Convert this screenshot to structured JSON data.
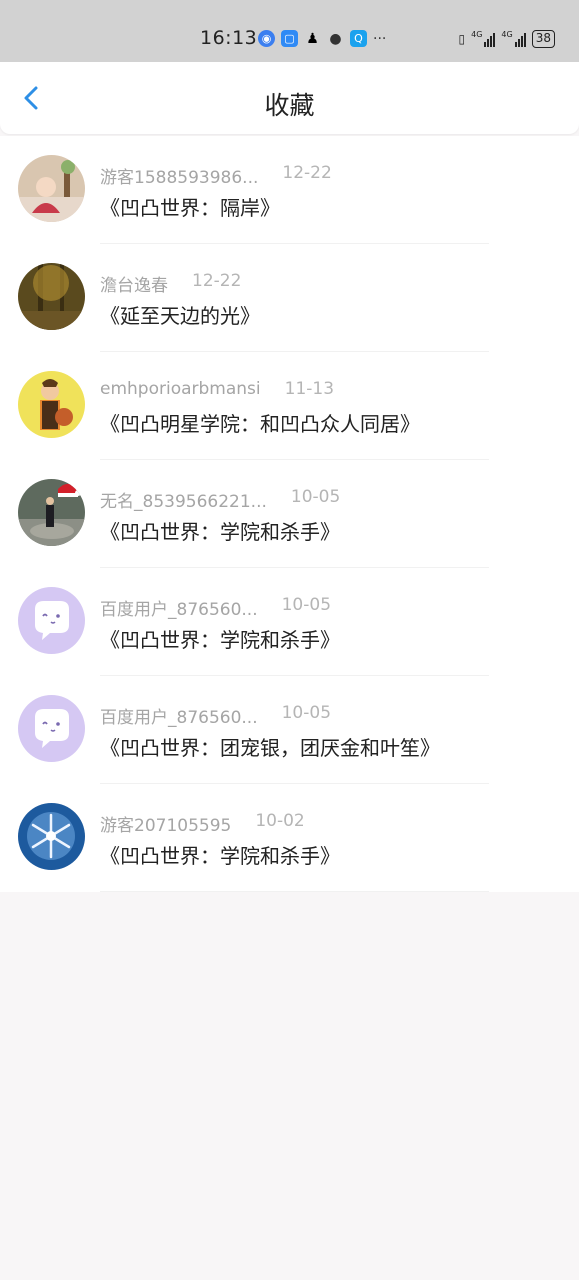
{
  "status_bar": {
    "time": "16:13",
    "battery": "38",
    "more": "···"
  },
  "header": {
    "title": "收藏"
  },
  "items": [
    {
      "user": "游客1588593986...",
      "date": "12-22",
      "book": "《凹凸世界：隔岸》"
    },
    {
      "user": "澹台逸春",
      "date": "12-22",
      "book": "《延至天边的光》"
    },
    {
      "user": "emhporioarbmansi",
      "date": "11-13",
      "book": "《凹凸明星学院：和凹凸众人同居》"
    },
    {
      "user": "无名_8539566221...",
      "date": "10-05",
      "book": "《凹凸世界：学院和杀手》"
    },
    {
      "user": "百度用户_876560...",
      "date": "10-05",
      "book": "《凹凸世界：学院和杀手》"
    },
    {
      "user": "百度用户_876560...",
      "date": "10-05",
      "book": "《凹凸世界：团宠银，团厌金和叶笙》"
    },
    {
      "user": "游客207105595",
      "date": "10-02",
      "book": "《凹凸世界：学院和杀手》"
    }
  ]
}
